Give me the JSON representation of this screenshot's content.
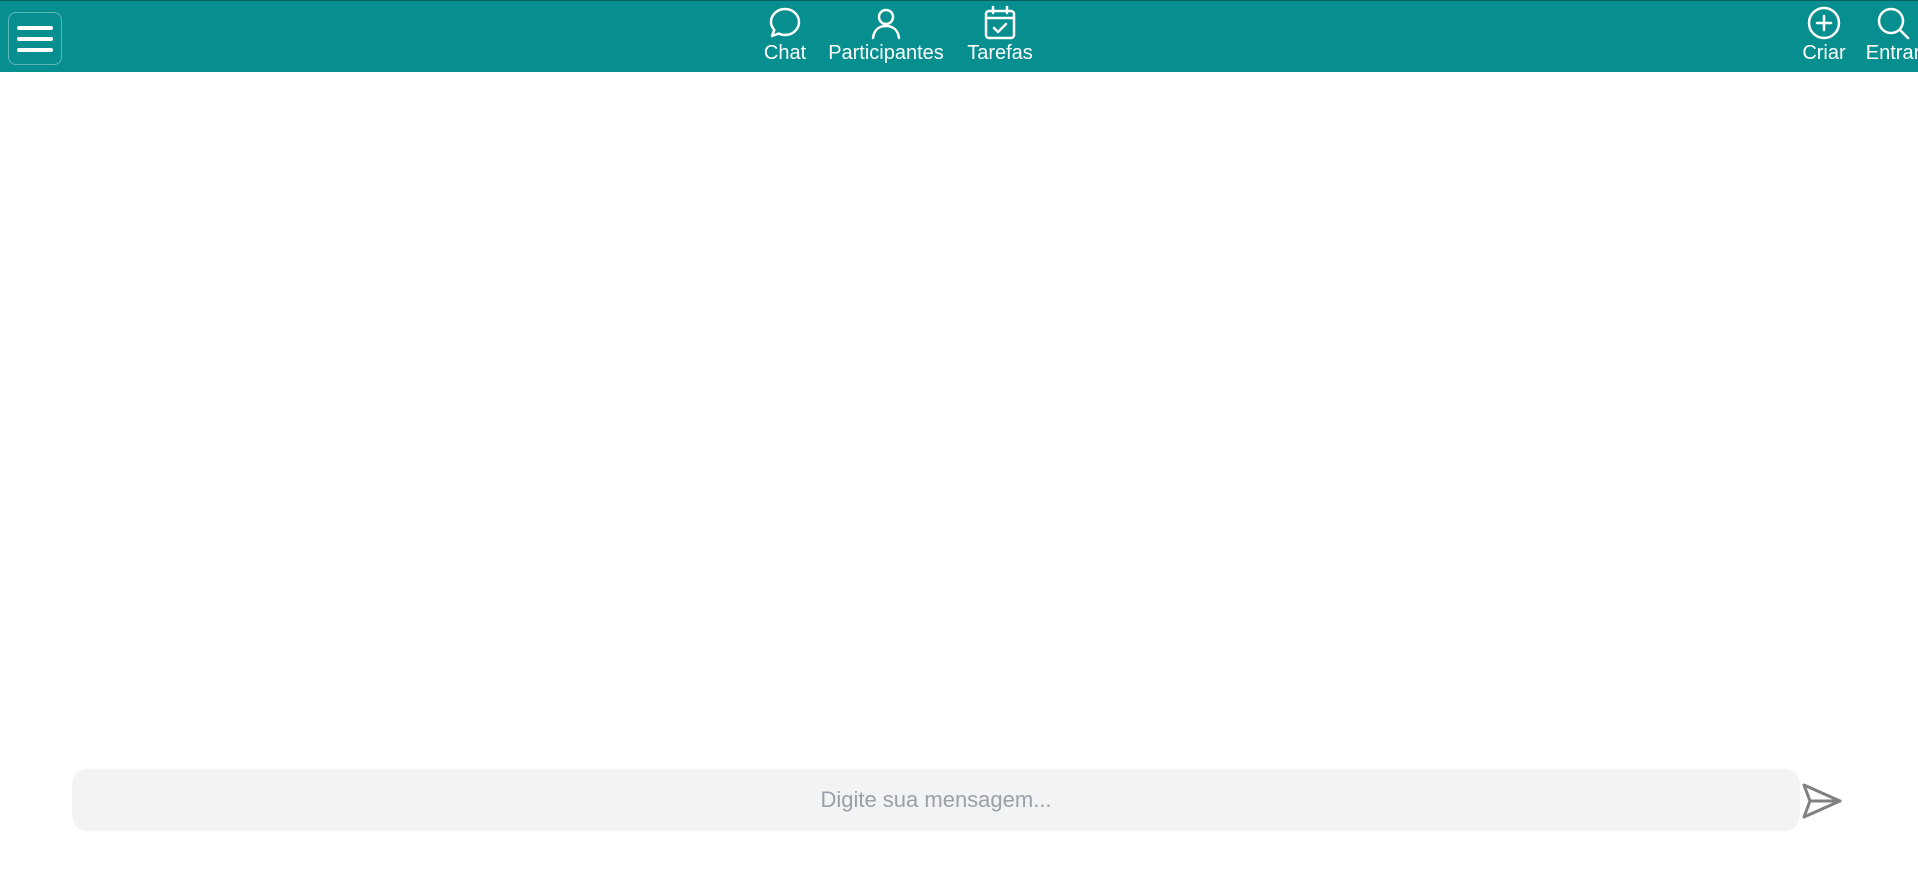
{
  "colors": {
    "header_bg": "#078f8f",
    "header_text": "#ffffff",
    "composer_bg": "#f2f3f5",
    "placeholder": "#9aa0a8",
    "send_icon": "#808080"
  },
  "header": {
    "menu_icon": "hamburger-icon",
    "nav": [
      {
        "label": "Chat",
        "icon": "chat-bubble-icon"
      },
      {
        "label": "Participantes",
        "icon": "user-icon"
      },
      {
        "label": "Tarefas",
        "icon": "calendar-check-icon"
      }
    ],
    "actions": [
      {
        "label": "Criar",
        "icon": "plus-circle-icon"
      },
      {
        "label": "Entrar",
        "icon": "search-icon"
      }
    ]
  },
  "composer": {
    "placeholder": "Digite sua mensagem...",
    "value": "",
    "send_icon": "send-icon"
  }
}
